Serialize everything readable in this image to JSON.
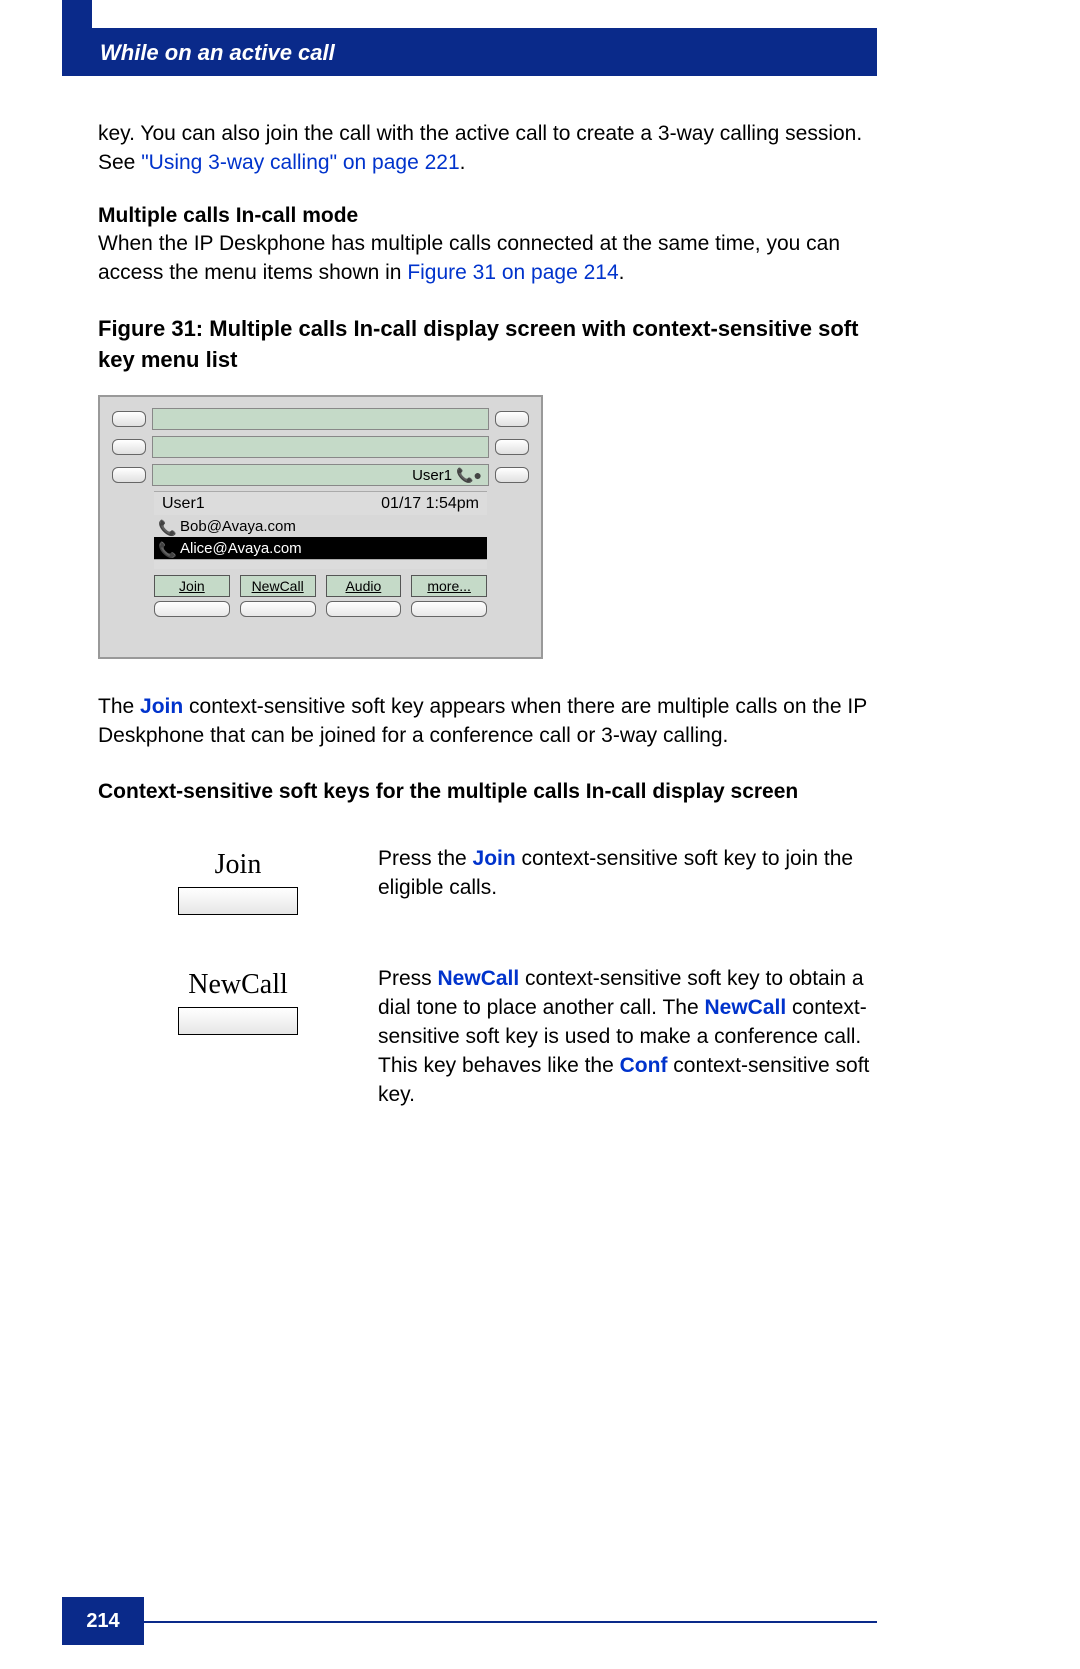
{
  "header": {
    "title": "While on an active call"
  },
  "intro": {
    "text1": "key. You can also join the call with the active call to create a 3-way calling session. See ",
    "link1": "\"Using 3-way calling\" on page 221",
    "text2": "."
  },
  "subhead1": "Multiple calls In-call mode",
  "para2_a": "When the IP Deskphone has multiple calls connected at the same time, you can access the menu items shown in ",
  "para2_link": "Figure 31 on page 214",
  "para2_b": ".",
  "figcap": "Figure 31: Multiple calls In-call display screen with context-sensitive soft key menu list",
  "phone": {
    "user_right": "User1",
    "user_left": "User1",
    "timestamp": "01/17 1:54pm",
    "call1": "Bob@Avaya.com",
    "call2": "Alice@Avaya.com",
    "softkeys": [
      "Join",
      "NewCall",
      "Audio",
      "more..."
    ]
  },
  "para3_a": "The ",
  "para3_join": "Join",
  "para3_b": " context-sensitive soft key appears when there are multiple calls on the IP Deskphone that can be joined for a conference call or 3-way calling.",
  "subhead2": "Context-sensitive soft keys for the multiple calls In-call display screen",
  "softkeys": {
    "join": {
      "label": "Join",
      "desc_a": "Press the ",
      "desc_key": "Join",
      "desc_b": " context-sensitive soft key to join the eligible calls."
    },
    "newcall": {
      "label": "NewCall",
      "desc_a": "Press ",
      "desc_key1": "NewCall",
      "desc_b": " context-sensitive soft key to obtain a dial tone to place another call. The ",
      "desc_key2": "NewCall",
      "desc_c": " context-sensitive soft key is used to make a conference call. This key behaves like the ",
      "desc_key3": "Conf",
      "desc_d": " context-sensitive soft key."
    }
  },
  "page_number": "214"
}
